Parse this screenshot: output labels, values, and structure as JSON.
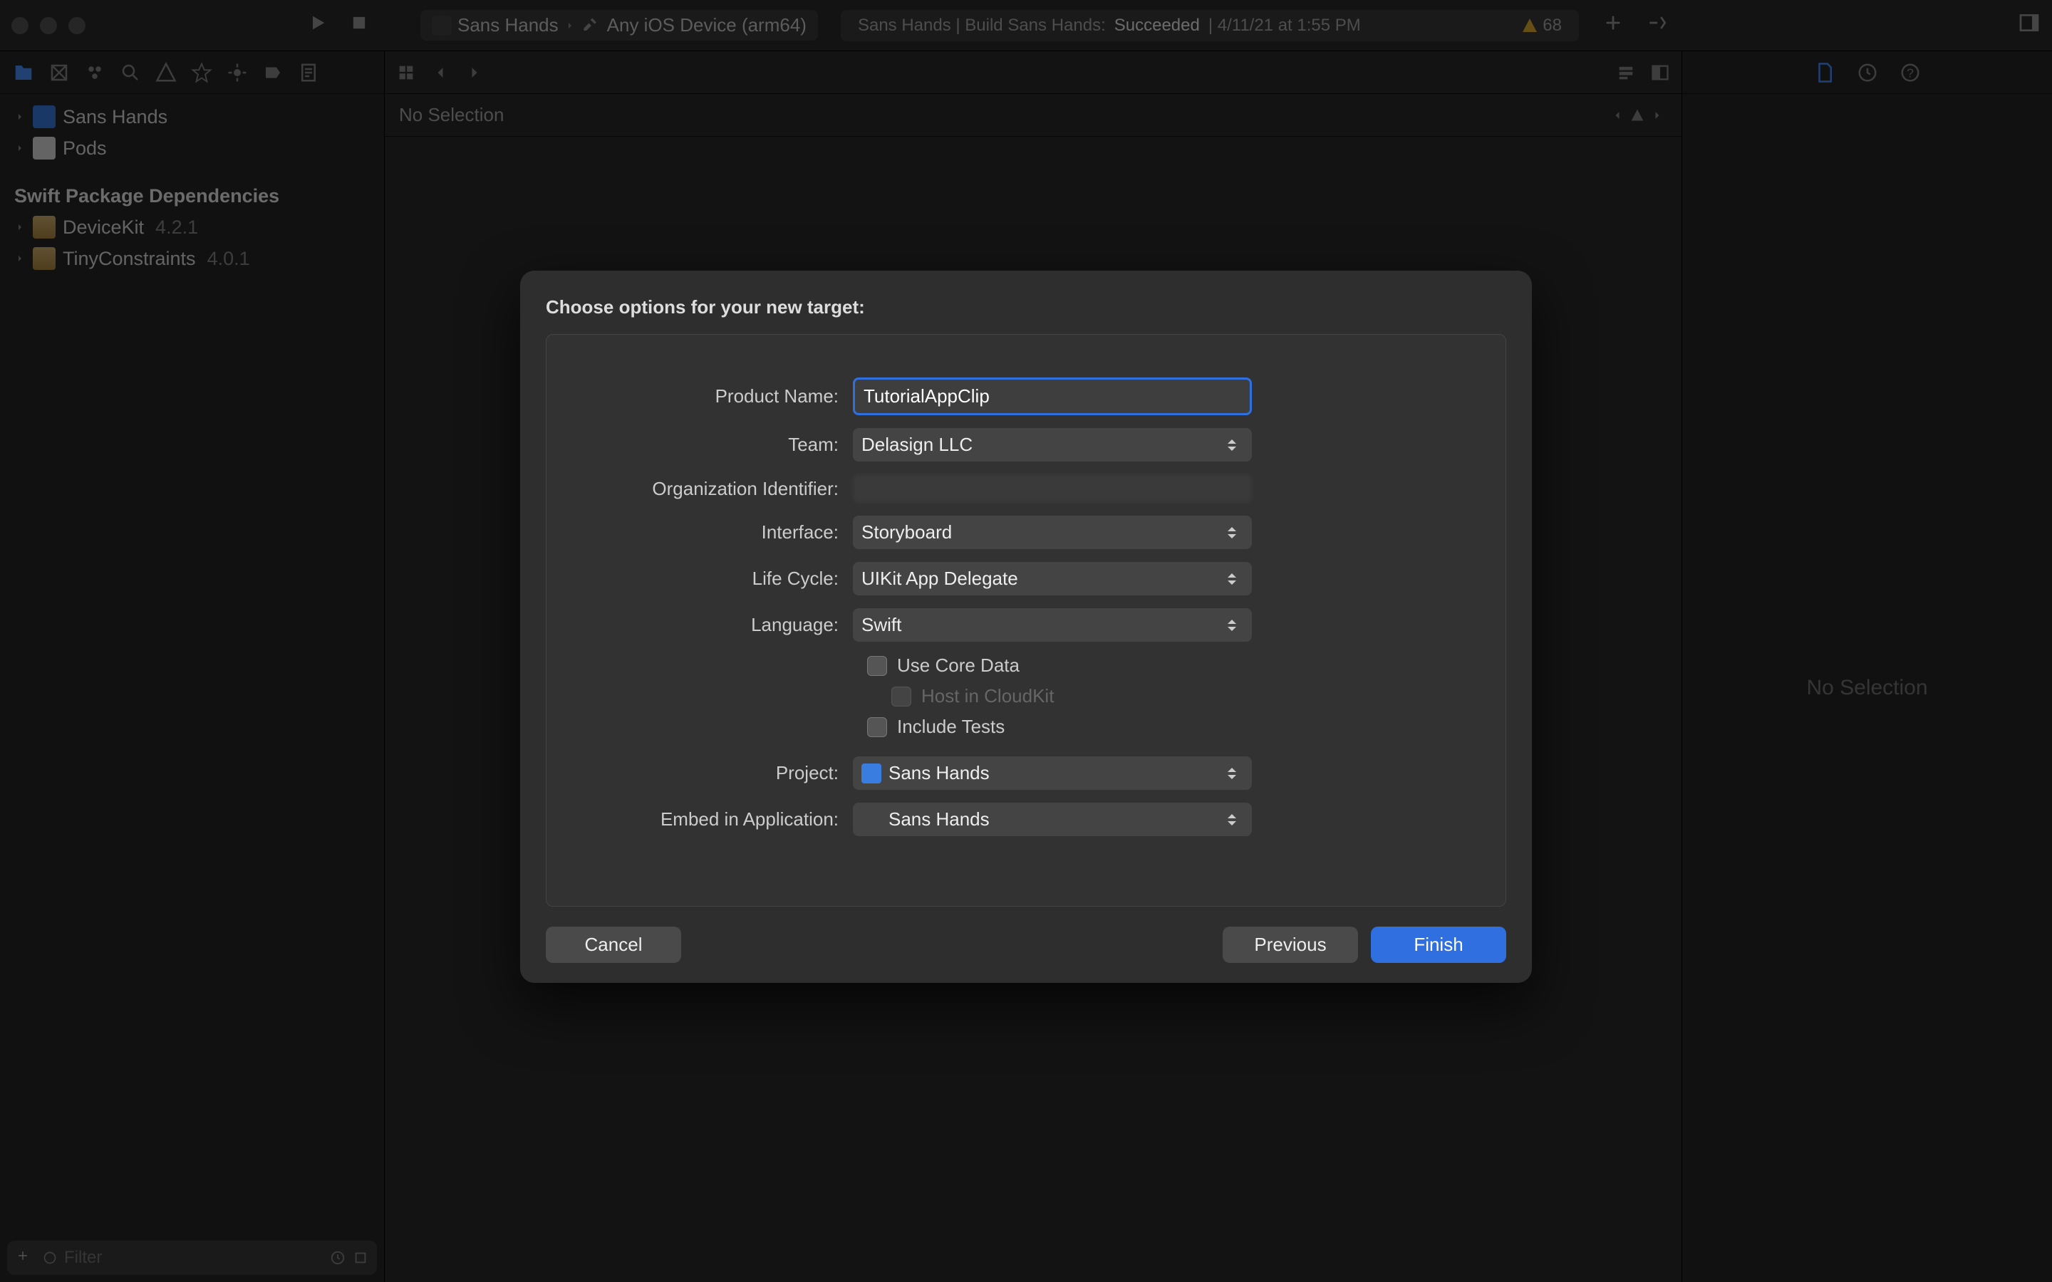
{
  "titlebar": {
    "scheme_project": "Sans Hands",
    "scheme_device": "Any iOS Device (arm64)",
    "status_prefix": "Sans Hands | Build Sans Hands:",
    "status_result": "Succeeded",
    "status_time": "| 4/11/21 at 1:55 PM",
    "warning_count": "68"
  },
  "navigator": {
    "filter_placeholder": "Filter",
    "items": [
      {
        "label": "Sans Hands"
      },
      {
        "label": "Pods"
      }
    ],
    "section_title": "Swift Package Dependencies",
    "packages": [
      {
        "name": "DeviceKit",
        "version": "4.2.1"
      },
      {
        "name": "TinyConstraints",
        "version": "4.0.1"
      }
    ]
  },
  "editor": {
    "breadcrumb": "No Selection"
  },
  "inspector": {
    "placeholder": "No Selection"
  },
  "sheet": {
    "title": "Choose options for your new target:",
    "labels": {
      "product_name": "Product Name:",
      "team": "Team:",
      "org_id": "Organization Identifier:",
      "interface": "Interface:",
      "life_cycle": "Life Cycle:",
      "language": "Language:",
      "project": "Project:",
      "embed": "Embed in Application:"
    },
    "values": {
      "product_name": "TutorialAppClip",
      "team": "Delasign LLC",
      "interface": "Storyboard",
      "life_cycle": "UIKit App Delegate",
      "language": "Swift",
      "project": "Sans Hands",
      "embed": "Sans Hands"
    },
    "checkboxes": {
      "core_data": "Use Core Data",
      "cloudkit": "Host in CloudKit",
      "include_tests": "Include Tests"
    },
    "buttons": {
      "cancel": "Cancel",
      "previous": "Previous",
      "finish": "Finish"
    }
  }
}
